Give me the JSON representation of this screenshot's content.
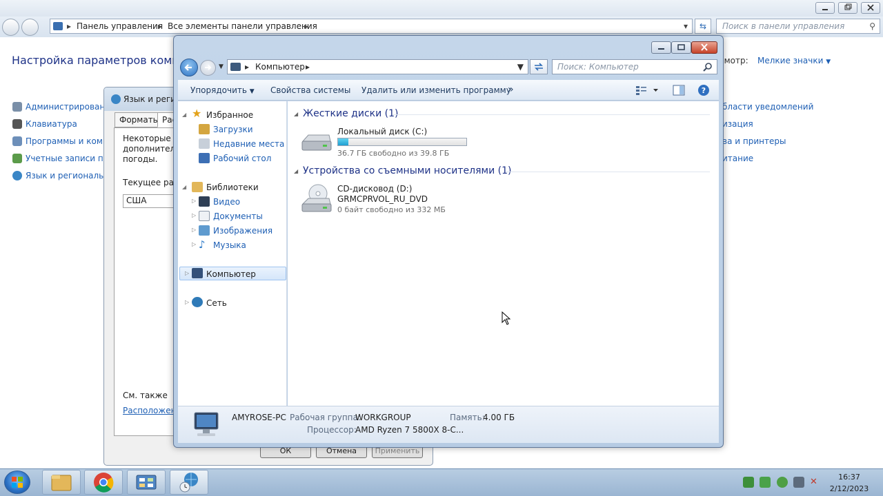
{
  "control_panel": {
    "breadcrumb": [
      "Панель управления",
      "Все элементы панели управления"
    ],
    "search_placeholder": "Поиск в панели управления",
    "heading": "Настройка параметров компьют",
    "view_label": "смотр:",
    "view_value": "Мелкие значки",
    "left_items": [
      "Администрирование",
      "Клавиатура",
      "Программы и компо",
      "Учетные записи пол",
      "Язык и региональ"
    ],
    "right_items": [
      "бласти уведомлений",
      "изация",
      "ва и принтеры",
      "итание"
    ]
  },
  "lang_dialog": {
    "title": "Язык и регио",
    "tabs": [
      "Форматы",
      "Рас"
    ],
    "text_lines": [
      "Некоторые п",
      "дополнитель",
      "погоды."
    ],
    "current_label": "Текущее рас",
    "current_value": "США",
    "see_also": "См. также",
    "link": "Расположени",
    "buttons": [
      "ОК",
      "Отмена",
      "Применить"
    ]
  },
  "explorer": {
    "breadcrumb": "Компьютер",
    "search_placeholder": "Поиск: Компьютер",
    "toolbar": {
      "organize": "Упорядочить",
      "system_properties": "Свойства системы",
      "uninstall": "Удалить или изменить программу",
      "more": "»"
    },
    "nav": {
      "favorites": "Избранное",
      "downloads": "Загрузки",
      "recent": "Недавние места",
      "desktop": "Рабочий стол",
      "libraries": "Библиотеки",
      "video": "Видео",
      "documents": "Документы",
      "pictures": "Изображения",
      "music": "Музыка",
      "computer": "Компьютер",
      "network": "Сеть"
    },
    "groups": {
      "hdd_title": "Жесткие диски (1)",
      "removable_title": "Устройства со съемными носителями (1)"
    },
    "drive_c": {
      "name": "Локальный диск (C:)",
      "free_text": "36.7 ГБ свободно из 39.8 ГБ",
      "used_fraction": 0.078
    },
    "drive_d": {
      "name": "CD-дисковод (D:)",
      "label": "GRMCPRVOL_RU_DVD",
      "free_text": "0 байт свободно из 332 МБ"
    },
    "details": {
      "pc_name": "AMYROSE-PC",
      "workgroup_label": "Рабочая группа:",
      "workgroup_value": "WORKGROUP",
      "memory_label": "Память:",
      "memory_value": "4.00 ГБ",
      "cpu_label": "Процессор:",
      "cpu_value": "AMD Ryzen 7 5800X 8-C..."
    }
  },
  "taskbar": {
    "time": "16:37",
    "date": "2/12/2023"
  },
  "colors": {
    "link_blue": "#1e5fb4",
    "heading_blue": "#1e3287",
    "close_red": "#c7442a"
  }
}
